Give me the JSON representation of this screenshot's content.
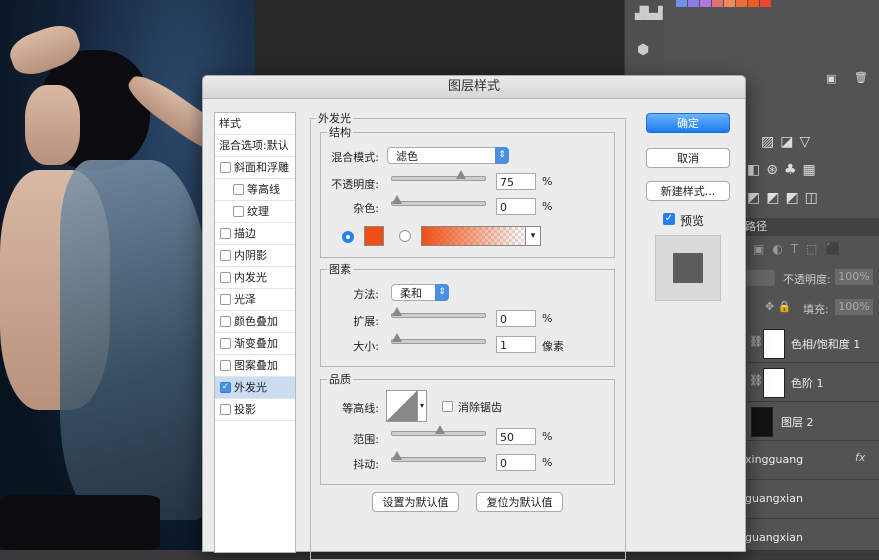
{
  "dialog": {
    "title": "图层样式",
    "style_list": {
      "header": "样式",
      "blend_default": "混合选项:默认",
      "items": [
        {
          "label": "斜面和浮雕",
          "checked": false,
          "indent": false
        },
        {
          "label": "等高线",
          "checked": false,
          "indent": true
        },
        {
          "label": "纹理",
          "checked": false,
          "indent": true
        },
        {
          "label": "描边",
          "checked": false,
          "indent": false
        },
        {
          "label": "内阴影",
          "checked": false,
          "indent": false
        },
        {
          "label": "内发光",
          "checked": false,
          "indent": false
        },
        {
          "label": "光泽",
          "checked": false,
          "indent": false
        },
        {
          "label": "颜色叠加",
          "checked": false,
          "indent": false
        },
        {
          "label": "渐变叠加",
          "checked": false,
          "indent": false
        },
        {
          "label": "图案叠加",
          "checked": false,
          "indent": false
        },
        {
          "label": "外发光",
          "checked": true,
          "indent": false,
          "selected": true
        },
        {
          "label": "投影",
          "checked": false,
          "indent": false
        }
      ]
    },
    "section_title": "外发光",
    "structure": {
      "title": "结构",
      "blend_mode_label": "混合模式:",
      "blend_mode_value": "滤色",
      "opacity_label": "不透明度:",
      "opacity_value": "75",
      "opacity_unit": "%",
      "opacity_level": 0.75,
      "noise_label": "杂色:",
      "noise_value": "0",
      "noise_unit": "%",
      "noise_level": 0,
      "color": "#f04e14"
    },
    "elements": {
      "title": "图素",
      "method_label": "方法:",
      "method_value": "柔和",
      "spread_label": "扩展:",
      "spread_value": "0",
      "spread_unit": "%",
      "spread_level": 0,
      "size_label": "大小:",
      "size_value": "1",
      "size_unit": "像素",
      "size_level": 0.004
    },
    "quality": {
      "title": "品质",
      "contour_label": "等高线:",
      "antialias_label": "消除锯齿",
      "range_label": "范围:",
      "range_value": "50",
      "range_unit": "%",
      "range_level": 0.5,
      "jitter_label": "抖动:",
      "jitter_value": "0",
      "jitter_unit": "%",
      "jitter_level": 0
    },
    "set_default_label": "设置为默认值",
    "reset_default_label": "复位为默认值",
    "ok_label": "确定",
    "cancel_label": "取消",
    "new_style_label": "新建样式...",
    "preview_label": "预览",
    "preview_checked": true
  },
  "right_panel": {
    "paths_tab": "路径",
    "opacity_label": "不透明度:",
    "opacity_value": "100%",
    "fill_label": "填充:",
    "fill_value": "100%",
    "layers": [
      {
        "name": "色相/饱和度 1"
      },
      {
        "name": "色阶 1"
      },
      {
        "name": "图层 2"
      },
      {
        "name": "xingguang",
        "fx": "fx"
      },
      {
        "name": "guangxian"
      },
      {
        "name": "guangxian"
      }
    ]
  },
  "swatches": [
    "#6f8fe8",
    "#8c7be6",
    "#b077e4",
    "#e86f6f",
    "#ef8b5a",
    "#f06a3c",
    "#ee5a2a",
    "#e8492a"
  ],
  "colors": {
    "accent": "#1c7bf3",
    "dialog_bg": "#ececec",
    "panel_bg": "#535353"
  }
}
